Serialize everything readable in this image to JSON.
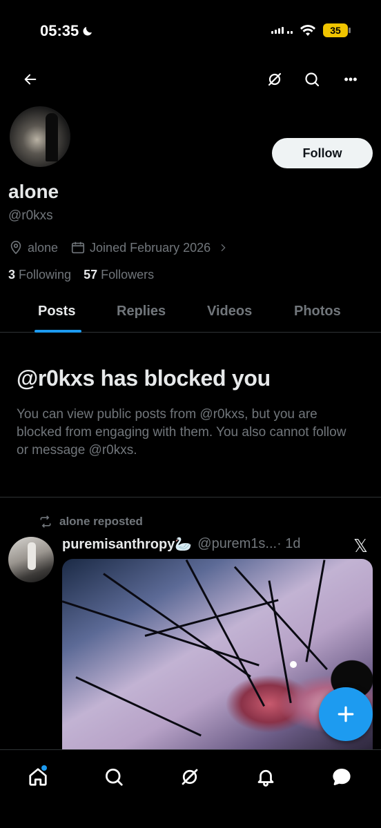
{
  "status_bar": {
    "time": "05:35",
    "battery": "35"
  },
  "profile": {
    "display_name": "alone",
    "handle": "@r0kxs",
    "location": "alone",
    "joined": "Joined February 2026",
    "following_count": "3",
    "following_label": "Following",
    "followers_count": "57",
    "followers_label": "Followers",
    "follow_button": "Follow"
  },
  "tabs": [
    {
      "label": "Posts",
      "active": true
    },
    {
      "label": "Replies",
      "active": false
    },
    {
      "label": "Videos",
      "active": false
    },
    {
      "label": "Photos",
      "active": false
    }
  ],
  "blocked": {
    "title": "@r0kxs has blocked you",
    "body": "You can view public posts from @r0kxs, but you are blocked from engaging with them. You also cannot follow or message @r0kxs."
  },
  "post": {
    "repost_label": "alone reposted",
    "author": "puremisanthropy🦢",
    "handle": "@purem1s...",
    "time": "· 1d"
  },
  "icons": {
    "top_nav": [
      "back-arrow-icon",
      "grok-icon",
      "search-icon",
      "more-icon"
    ],
    "bottom_nav": [
      "home-icon",
      "search-icon",
      "grok-icon",
      "notifications-icon",
      "messages-icon"
    ]
  },
  "colors": {
    "accent": "#1d9bf0",
    "muted": "#71767b",
    "background": "#000000"
  }
}
